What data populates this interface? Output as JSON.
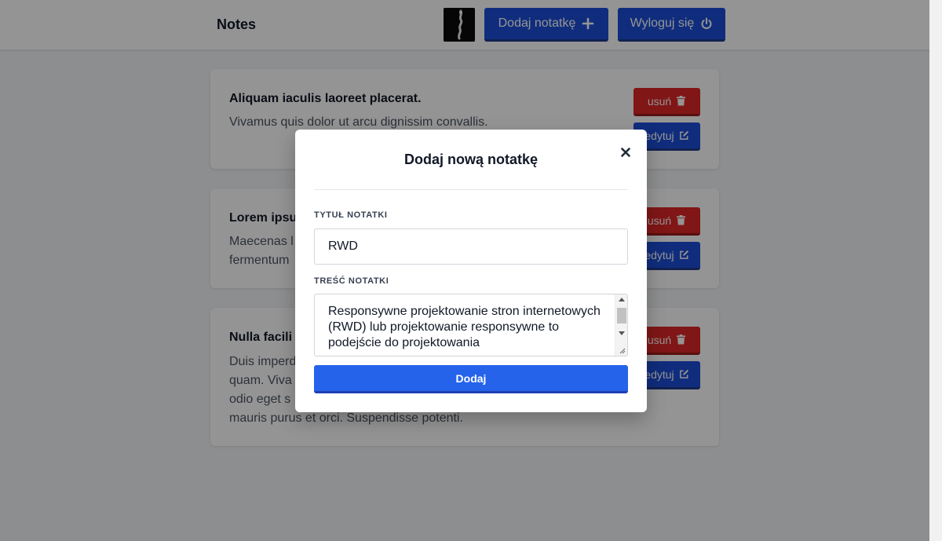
{
  "header": {
    "title": "Notes",
    "add_note_label": "Dodaj notatkę",
    "logout_label": "Wyloguj się"
  },
  "notes": [
    {
      "title": "Aliquam iaculis laoreet placerat.",
      "body": "Vivamus quis dolor ut arcu dignissim convallis.",
      "delete_label": "usuń",
      "edit_label": "edytuj"
    },
    {
      "title": "Lorem ipsu",
      "body_line1": "Maecenas l",
      "body_line2": "fermentum",
      "delete_label": "usuń",
      "edit_label": "edytuj"
    },
    {
      "title": "Nulla facili",
      "body_line1": "Duis imperd",
      "body_line2": "quam. Viva",
      "body_line3": "odio eget s",
      "body_line4": "mauris purus et orci. Suspendisse potenti.",
      "delete_label": "usuń",
      "edit_label": "edytuj"
    }
  ],
  "modal": {
    "title": "Dodaj nową notatkę",
    "close_symbol": "×",
    "title_label": "TYTUŁ NOTATKI",
    "title_value": "RWD",
    "content_label": "TREŚĆ NOTATKI",
    "content_value": "Responsywne projektowanie stron internetowych (RWD) lub projektowanie responsywne to podejście do projektowania",
    "submit_label": "Dodaj"
  },
  "colors": {
    "primary": "#1d4ed8",
    "danger": "#dc2626",
    "submit": "#2563eb"
  },
  "icons": [
    "plus-icon",
    "power-icon",
    "trash-icon",
    "edit-icon",
    "close-icon"
  ]
}
